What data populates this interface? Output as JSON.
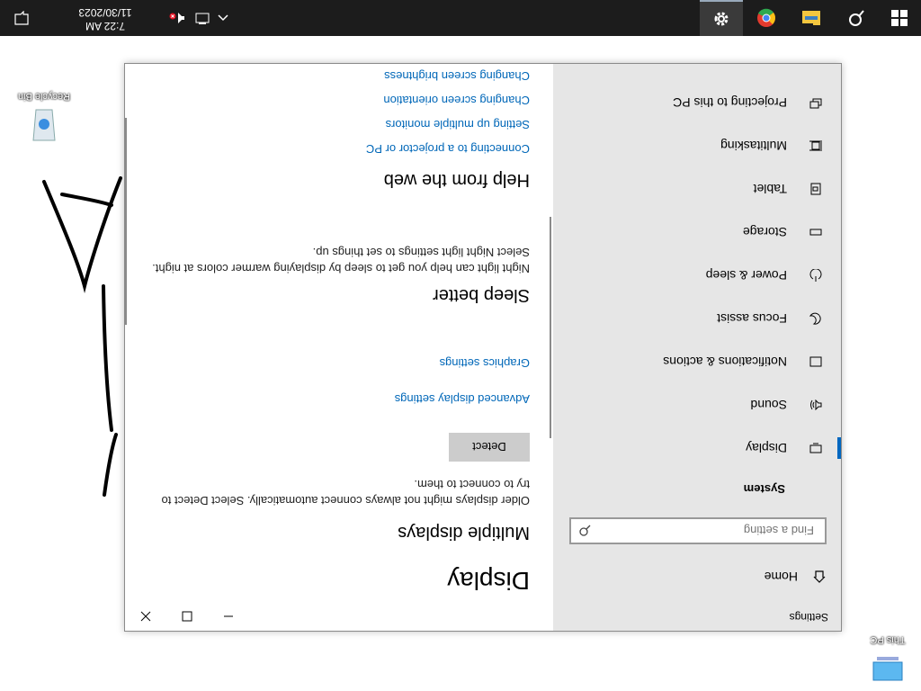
{
  "taskbar": {
    "clock_time": "7:22 AM",
    "clock_date": "11/30/2023"
  },
  "desktop": {
    "icons": [
      {
        "label": "This PC"
      },
      {
        "label": "Recycle Bin"
      }
    ]
  },
  "window": {
    "title": "Settings",
    "nav_home": "Home",
    "search_placeholder": "Find a setting",
    "section_heading": "System",
    "nav_items": [
      {
        "label": "Display",
        "icon": "monitor-icon"
      },
      {
        "label": "Sound",
        "icon": "speaker-icon"
      },
      {
        "label": "Notifications & actions",
        "icon": "notification-icon"
      },
      {
        "label": "Focus assist",
        "icon": "moon-icon"
      },
      {
        "label": "Power & sleep",
        "icon": "power-icon"
      },
      {
        "label": "Storage",
        "icon": "storage-icon"
      },
      {
        "label": "Tablet",
        "icon": "tablet-icon"
      },
      {
        "label": "Multitasking",
        "icon": "multitasking-icon"
      },
      {
        "label": "Projecting to this PC",
        "icon": "projecting-icon"
      }
    ],
    "selected_item": "Display",
    "accent_color": "#0067c0",
    "content": {
      "page_title": "Display",
      "multiple_displays_heading": "Multiple displays",
      "multiple_displays_text": "Older displays might not always connect automatically. Select Detect to try to connect to them.",
      "detect_button": "Detect",
      "advanced_link": "Advanced display settings",
      "graphics_link": "Graphics settings",
      "sleep_heading": "Sleep better",
      "sleep_text": "Night light can help you get to sleep by displaying warmer colors at night. Select Night light settings to set things up.",
      "help_heading": "Help from the web",
      "help_links": [
        "Connecting to a projector or PC",
        "Setting up multiple monitors",
        "Changing screen orientation",
        "Changing screen brightness"
      ]
    }
  }
}
